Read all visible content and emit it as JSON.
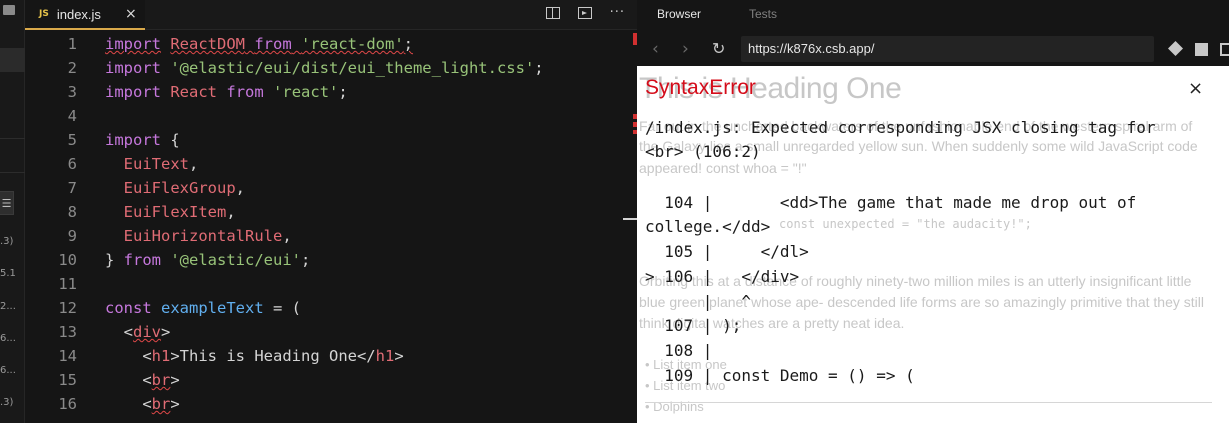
{
  "sidebar": {
    "lines_icon": "☰",
    "version_numbers": [
      ".3)",
      "5.1",
      "2...",
      "6...",
      "6...",
      ".3)"
    ]
  },
  "tab": {
    "badge": "JS",
    "filename": "index.js",
    "close": "×"
  },
  "toolbar": {
    "more": "···"
  },
  "code": [
    {
      "n": "1",
      "tokens": [
        {
          "t": "import",
          "c": "kw",
          "sq": true
        },
        {
          "t": " ",
          "c": "pl"
        },
        {
          "t": "ReactDOM",
          "c": "var",
          "sq": true
        },
        {
          "t": " ",
          "c": "pl",
          "sq": true
        },
        {
          "t": "from",
          "c": "kw",
          "sq": true
        },
        {
          "t": " ",
          "c": "pl",
          "sq": true
        },
        {
          "t": "'react-dom'",
          "c": "str",
          "sq": true
        },
        {
          "t": ";",
          "c": "pl",
          "sq": true
        }
      ]
    },
    {
      "n": "2",
      "tokens": [
        {
          "t": "import",
          "c": "kw"
        },
        {
          "t": " ",
          "c": "pl"
        },
        {
          "t": "'@elastic/eui/dist/eui_theme_light.css'",
          "c": "str"
        },
        {
          "t": ";",
          "c": "pl"
        }
      ]
    },
    {
      "n": "3",
      "tokens": [
        {
          "t": "import",
          "c": "kw"
        },
        {
          "t": " ",
          "c": "pl"
        },
        {
          "t": "React",
          "c": "var"
        },
        {
          "t": " ",
          "c": "pl"
        },
        {
          "t": "from",
          "c": "kw"
        },
        {
          "t": " ",
          "c": "pl"
        },
        {
          "t": "'react'",
          "c": "str"
        },
        {
          "t": ";",
          "c": "pl"
        }
      ]
    },
    {
      "n": "4",
      "tokens": []
    },
    {
      "n": "5",
      "tokens": [
        {
          "t": "import",
          "c": "kw"
        },
        {
          "t": " {",
          "c": "pl"
        }
      ]
    },
    {
      "n": "6",
      "tokens": [
        {
          "t": "  ",
          "c": "pl"
        },
        {
          "t": "EuiText",
          "c": "var"
        },
        {
          "t": ",",
          "c": "pl"
        }
      ]
    },
    {
      "n": "7",
      "tokens": [
        {
          "t": "  ",
          "c": "pl"
        },
        {
          "t": "EuiFlexGroup",
          "c": "var"
        },
        {
          "t": ",",
          "c": "pl"
        }
      ]
    },
    {
      "n": "8",
      "tokens": [
        {
          "t": "  ",
          "c": "pl"
        },
        {
          "t": "EuiFlexItem",
          "c": "var"
        },
        {
          "t": ",",
          "c": "pl"
        }
      ]
    },
    {
      "n": "9",
      "tokens": [
        {
          "t": "  ",
          "c": "pl"
        },
        {
          "t": "EuiHorizontalRule",
          "c": "var"
        },
        {
          "t": ",",
          "c": "pl"
        }
      ]
    },
    {
      "n": "10",
      "tokens": [
        {
          "t": "} ",
          "c": "pl"
        },
        {
          "t": "from",
          "c": "kw"
        },
        {
          "t": " ",
          "c": "pl"
        },
        {
          "t": "'@elastic/eui'",
          "c": "str"
        },
        {
          "t": ";",
          "c": "pl"
        }
      ]
    },
    {
      "n": "11",
      "tokens": []
    },
    {
      "n": "12",
      "tokens": [
        {
          "t": "const",
          "c": "kw"
        },
        {
          "t": " ",
          "c": "pl"
        },
        {
          "t": "exampleText",
          "c": "fn"
        },
        {
          "t": " = (",
          "c": "pl"
        }
      ]
    },
    {
      "n": "13",
      "tokens": [
        {
          "t": "  <",
          "c": "pl"
        },
        {
          "t": "div",
          "c": "var",
          "sq": true
        },
        {
          "t": ">",
          "c": "pl"
        }
      ]
    },
    {
      "n": "14",
      "tokens": [
        {
          "t": "    <",
          "c": "pl"
        },
        {
          "t": "h1",
          "c": "var"
        },
        {
          "t": ">This is Heading One</",
          "c": "pl"
        },
        {
          "t": "h1",
          "c": "var"
        },
        {
          "t": ">",
          "c": "pl"
        }
      ]
    },
    {
      "n": "15",
      "tokens": [
        {
          "t": "    <",
          "c": "pl"
        },
        {
          "t": "br",
          "c": "var",
          "sq": true
        },
        {
          "t": ">",
          "c": "pl"
        }
      ]
    },
    {
      "n": "16",
      "tokens": [
        {
          "t": "    <",
          "c": "pl"
        },
        {
          "t": "br",
          "c": "var",
          "sq": true
        },
        {
          "t": ">",
          "c": "pl"
        }
      ]
    }
  ],
  "browser": {
    "tabs": [
      "Browser",
      "Tests"
    ],
    "back_icon": "‹",
    "forward_icon": "›",
    "reload_icon": "↻",
    "url": "https://k876x.csb.app/"
  },
  "preview_ghost": {
    "heading": "This is Heading One",
    "p1a": "Far out in the uncharted backwaters of the unfashionable end of the western spiral arm of",
    "p1b": "the Galaxy lies a small unregarded yellow sun. When suddenly some wild JavaScript code",
    "p1c": "appeared! const whoa = \"!\"",
    "code2": "const unexpected = \"the audacity!\";",
    "p2a": "Orbiting this at a distance of roughly ninety-two million miles is an utterly insignificant little",
    "p2b": "blue green planet whose ape- descended life forms are so amazingly primitive that they still",
    "p2c": "think digital watches are a pretty neat idea.",
    "list": [
      "List item one",
      "List item two",
      "Dolphins"
    ]
  },
  "error": {
    "title": "SyntaxError",
    "close": "×",
    "lines": [
      "/index.js: Expected corresponding JSX closing tag for",
      "<br> (106:2)",
      "",
      "  104 |       <dd>The game that made me drop out of",
      "college.</dd>",
      "  105 |     </dl>",
      "> 106 |   </div>",
      "      |   ^",
      "  107 | );",
      "  108 |",
      "  109 | const Demo = () => ("
    ]
  }
}
